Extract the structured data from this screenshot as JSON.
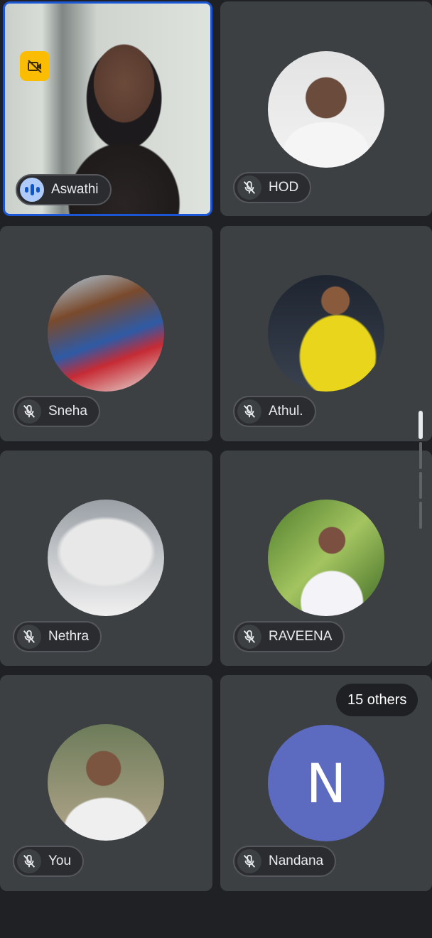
{
  "participants": [
    {
      "name": "Aswathi",
      "speaking": true,
      "camera": "video",
      "camera_off_icon": "video-off-icon"
    },
    {
      "name": "HOD",
      "muted": true,
      "avatar": "photo"
    },
    {
      "name": "Sneha",
      "muted": true,
      "avatar": "photo"
    },
    {
      "name": "Athul.",
      "muted": true,
      "avatar": "photo"
    },
    {
      "name": "Nethra",
      "muted": true,
      "avatar": "photo"
    },
    {
      "name": "RAVEENA",
      "muted": true,
      "avatar": "photo"
    },
    {
      "name": "You",
      "muted": true,
      "avatar": "photo"
    },
    {
      "name": "Nandana",
      "muted": true,
      "avatar": "initial",
      "initial": "N"
    }
  ],
  "others_count_label": "15 others",
  "icons": {
    "muted": "mic-off-icon",
    "speaking": "audio-bars-icon",
    "camera_off": "video-off-icon"
  },
  "colors": {
    "background": "#202124",
    "tile": "#3c4043",
    "active_border": "#1a56d6",
    "speaking_badge": "#aecbfa",
    "camera_off_badge": "#fbbc04",
    "initial_avatar": "#5c6bc0"
  }
}
